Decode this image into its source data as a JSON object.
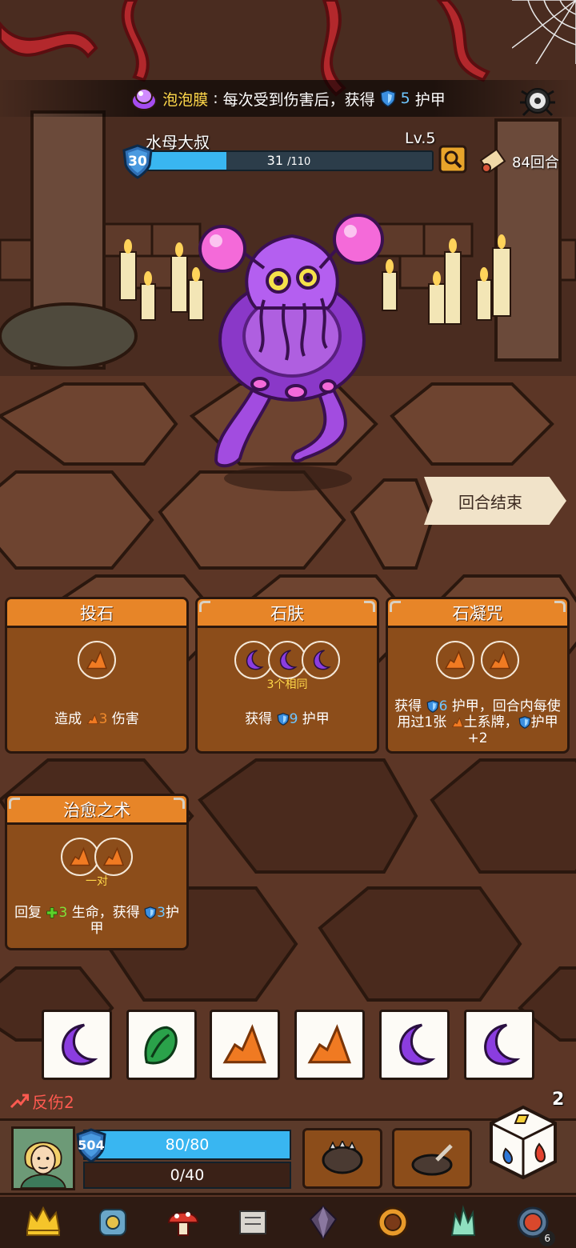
{
  "colors": {
    "hp_blue": "#39b6f1",
    "card_header": "#e78528",
    "card_body": "#8c4d1a",
    "gold_text": "#ffd84a",
    "shield_blue": "#6ec6ff",
    "reflect_red": "#ff5a50",
    "heal_green": "#7ee23a"
  },
  "buff": {
    "icon": "bubble-membrane-icon",
    "name": "泡泡膜",
    "colon": ":",
    "text_before": "每次受到伤害后，获得",
    "shield_value": "5",
    "text_after": "护甲"
  },
  "enemy": {
    "name": "水母大叔",
    "level": "Lv.5",
    "armor": "30",
    "hp_current": "31",
    "hp_max": "/110",
    "hp_fraction": 0.2818
  },
  "round": {
    "icon": "scroll-icon",
    "text": "84回合"
  },
  "end_turn_label": "回合结束",
  "cards": [
    {
      "title": "投石",
      "slots": [
        "earth"
      ],
      "note": "",
      "desc": [
        {
          "t": "造成 "
        },
        {
          "icon": "earth-icon",
          "v": "3",
          "c": "orange"
        },
        {
          "t": " 伤害"
        }
      ]
    },
    {
      "title": "石肤",
      "slots": [
        "moon",
        "moon",
        "moon"
      ],
      "note": "3个相同",
      "desc": [
        {
          "t": "获得 "
        },
        {
          "icon": "shield-icon",
          "v": "9",
          "c": "blue"
        },
        {
          "t": " 护甲"
        }
      ]
    },
    {
      "title": "石凝咒",
      "slots": [
        "earth",
        "earth"
      ],
      "note": "",
      "desc": [
        {
          "t": "获得 "
        },
        {
          "icon": "shield-icon",
          "v": "6",
          "c": "blue"
        },
        {
          "t": " 护甲，回合内每使用过1张 "
        },
        {
          "icon": "earth-icon",
          "v": "",
          "c": "orange"
        },
        {
          "t": "土系牌，"
        },
        {
          "icon": "shield-icon",
          "v": "",
          "c": "blue"
        },
        {
          "t": "护甲+2"
        }
      ]
    },
    {
      "title": "治愈之术",
      "slots": [
        "earth",
        "earth"
      ],
      "note": "一对",
      "desc": [
        {
          "t": "回复 "
        },
        {
          "icon": "heal-icon",
          "v": "3",
          "c": "green"
        },
        {
          "t": " 生命，获得 "
        },
        {
          "icon": "shield-icon",
          "v": "3",
          "c": "blue"
        },
        {
          "t": "护甲"
        }
      ]
    }
  ],
  "dice": [
    "moon",
    "leaf",
    "earth",
    "earth",
    "moon",
    "moon"
  ],
  "player": {
    "reflect_label": "反伤2",
    "armor": "504",
    "hp": "80/80",
    "hp_fraction": 1,
    "xp": "0/40",
    "dice_remaining": "2"
  },
  "skills": [
    "fist-icon",
    "dig-icon"
  ],
  "relics": [
    {
      "name": "crown-icon",
      "count": ""
    },
    {
      "name": "armor-icon",
      "count": ""
    },
    {
      "name": "mushroom-icon",
      "count": ""
    },
    {
      "name": "scroll-map-icon",
      "count": ""
    },
    {
      "name": "crystal-icon",
      "count": ""
    },
    {
      "name": "amulet-icon",
      "count": ""
    },
    {
      "name": "ice-crystal-icon",
      "count": ""
    },
    {
      "name": "rune-orb-icon",
      "count": "6"
    }
  ]
}
